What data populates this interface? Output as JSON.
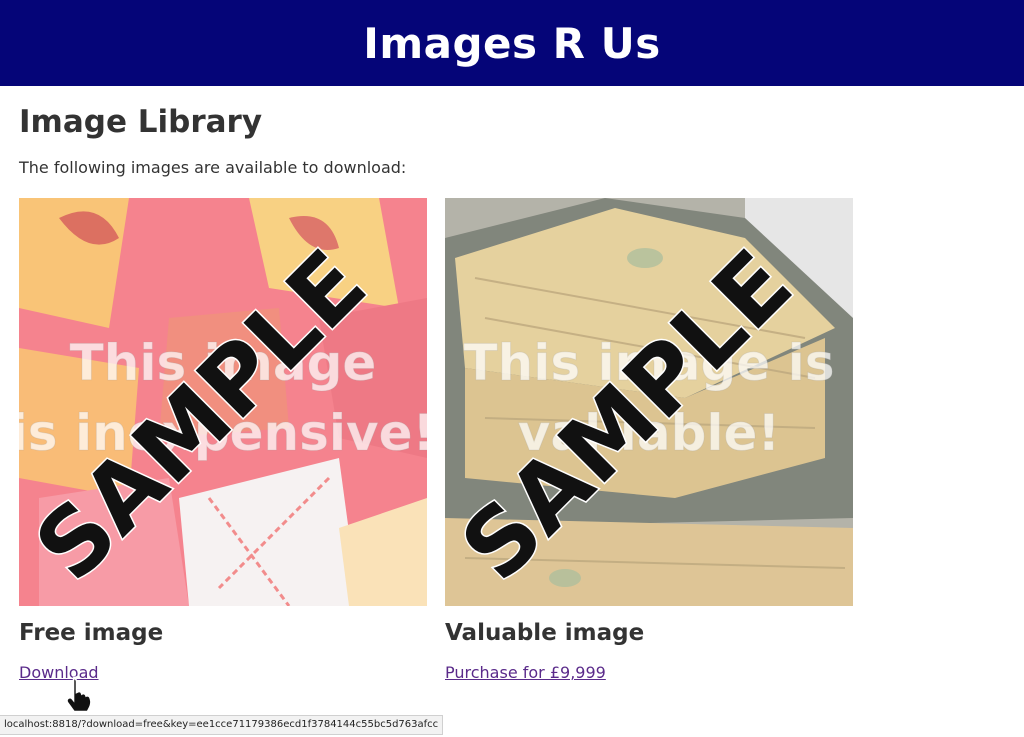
{
  "header": {
    "title": "Images R Us",
    "background_color": "#050578"
  },
  "main": {
    "title": "Image Library",
    "intro": "The following images are available to download:"
  },
  "cards": [
    {
      "overlay_text_line1": "This image",
      "overlay_text_line2": "is inexpensive!",
      "watermark": "SAMPLE",
      "title": "Free image",
      "link_label": "Download"
    },
    {
      "overlay_text_line1": "This image is",
      "overlay_text_line2": "valuable!",
      "watermark": "SAMPLE",
      "title": "Valuable image",
      "link_label": "Purchase for £9,999"
    }
  ],
  "status_bar": {
    "url": "localhost:8818/?download=free&key=ee1cce71179386ecd1f3784144c55bc5d763afcc"
  },
  "cursor": {
    "icon": "hand-pointer-icon"
  },
  "colors": {
    "link": "#5a2a8a",
    "text": "#333333"
  }
}
